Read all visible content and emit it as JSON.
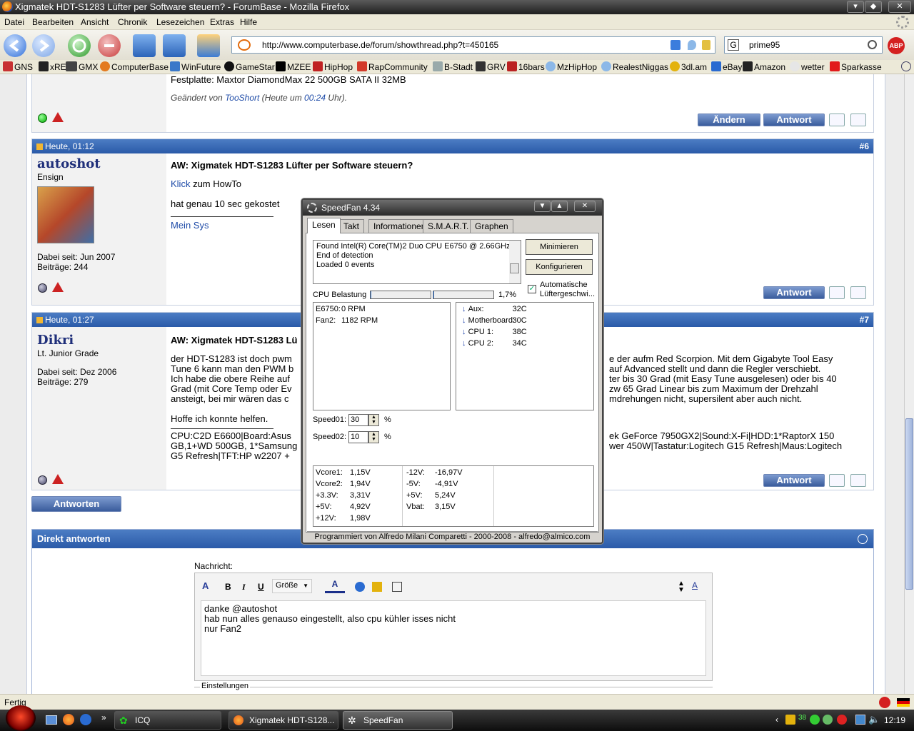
{
  "window": {
    "title": "Xigmatek HDT-S1283 Lüfter per Software steuern? - ForumBase - Mozilla Firefox"
  },
  "menu": [
    "Datei",
    "Bearbeiten",
    "Ansicht",
    "Chronik",
    "Lesezeichen",
    "Extras",
    "Hilfe"
  ],
  "nav": {
    "url": "http://www.computerbase.de/forum/showthread.php?t=450165",
    "search": "prime95"
  },
  "bookmarks": [
    "GNS",
    "xREL",
    "GMX",
    "ComputerBase",
    "WinFuture",
    "GameStar",
    "MZEE",
    "HipHop",
    "RapCommunity",
    "B-Stadt",
    "GRV",
    "16bars",
    "MzHipHop",
    "RealestNiggas",
    "3dl.am",
    "eBay",
    "Amazon",
    "wetter",
    "Sparkasse"
  ],
  "post_top": {
    "line1": "Festplatte: Maxtor DiamondMax 22 500GB SATA II 32MB",
    "edited_prefix": "Geändert von ",
    "edited_user": "TooShort",
    "edited_mid": " (Heute um ",
    "edited_time": "00:24",
    "edited_suffix": " Uhr).",
    "btn_edit": "Ändern",
    "btn_reply": "Antwort"
  },
  "post6": {
    "date": "Heute, 01:12",
    "num": "#6",
    "user": "autoshot",
    "rank": "Ensign",
    "joined": "Dabei seit: Jun 2007",
    "posts": "Beiträge: 244",
    "title": "AW: Xigmatek HDT-S1283 Lüfter per Software steuern?",
    "link": "Klick",
    "line1_rest": " zum HowTo",
    "line2": "hat genau 10 sec gekostet",
    "sig": "Mein Sys",
    "btn_reply": "Antwort"
  },
  "post7": {
    "date": "Heute, 01:27",
    "num": "#7",
    "user": "Dikri",
    "rank": "Lt. Junior Grade",
    "joined": "Dabei seit: Dez 2006",
    "posts": "Beiträge: 279",
    "title": "AW: Xigmatek HDT-S1283 Lü",
    "left_lines": [
      "der HDT-S1283 ist doch pwm",
      "Tune 6 kann man den PWM b",
      "Ich habe die obere Reihe auf",
      "Grad (mit Core Temp oder Ev",
      "ansteigt, bei mir wären das c"
    ],
    "right_lines": [
      "e der aufm Red Scorpion. Mit dem Gigabyte Tool Easy",
      "auf Advanced stellt und dann die Regler verschiebt.",
      "ter bis 30 Grad (mit Easy Tune ausgelesen) oder bis 40",
      "zw 65 Grad Linear bis zum Maximum der Drehzahl",
      "mdrehungen nicht, supersilent aber auch nicht."
    ],
    "hope": "Hoffe ich konnte helfen.",
    "sig_left": [
      "CPU:C2D E6600|Board:Asus",
      "GB,1+WD 500GB, 1*Samsung",
      "G5 Refresh|TFT:HP w2207 +"
    ],
    "sig_right": [
      "ek GeForce 7950GX2|Sound:X-Fi|HDD:1*RaptorX 150",
      "wer 450W|Tastatur:Logitech G15 Refresh|Maus:Logitech"
    ],
    "btn_reply": "Antwort"
  },
  "antworten": "Antworten",
  "direct": {
    "title": "Direkt antworten",
    "label": "Nachricht:",
    "size": "Größe",
    "message": [
      "danke @autoshot",
      "hab nun alles genauso eingestellt, also cpu kühler isses nicht",
      "nur Fan2"
    ],
    "settings": "Einstellungen"
  },
  "speedfan": {
    "title": "SpeedFan 4.34",
    "tabs": [
      "Lesen",
      "Takt",
      "Informationen",
      "S.M.A.R.T.",
      "Graphen"
    ],
    "log": [
      "Found Intel(R) Core(TM)2 Duo CPU E6750 @ 2.66GHz",
      "End of detection",
      "Loaded 0 events"
    ],
    "btn_min": "Minimieren",
    "btn_cfg": "Konfigurieren",
    "auto": [
      "Automatische",
      "Lüftergeschwi..."
    ],
    "auto_checked": true,
    "cpu_label": "CPU Belastung",
    "cpu_value": "1,7%",
    "fans": [
      {
        "name": "E6750:",
        "value": "0 RPM"
      },
      {
        "name": "Fan2:",
        "value": "1182 RPM"
      }
    ],
    "temps": [
      {
        "name": "Aux:",
        "value": "32C"
      },
      {
        "name": "Motherboard:",
        "value": "30C"
      },
      {
        "name": "CPU 1:",
        "value": "38C"
      },
      {
        "name": "CPU 2:",
        "value": "34C"
      }
    ],
    "speeds": [
      {
        "name": "Speed01:",
        "value": "30",
        "unit": "%"
      },
      {
        "name": "Speed02:",
        "value": "10",
        "unit": "%"
      }
    ],
    "volts_left": [
      {
        "name": "Vcore1:",
        "value": "1,15V"
      },
      {
        "name": "Vcore2:",
        "value": "1,94V"
      },
      {
        "name": "+3.3V:",
        "value": "3,31V"
      },
      {
        "name": "+5V:",
        "value": "4,92V"
      },
      {
        "name": "+12V:",
        "value": "1,98V"
      }
    ],
    "volts_right": [
      {
        "name": "-12V:",
        "value": "-16,97V"
      },
      {
        "name": "-5V:",
        "value": "-4,91V"
      },
      {
        "name": "+5V:",
        "value": "5,24V"
      },
      {
        "name": "Vbat:",
        "value": "3,15V"
      }
    ],
    "footer": "Programmiert von Alfredo Milani Comparetti - 2000-2008 - alfredo@almico.com"
  },
  "status": {
    "text": "Fertig"
  },
  "taskbar": {
    "tasks": [
      "ICQ",
      "Xigmatek HDT-S128...",
      "SpeedFan"
    ],
    "clock": "12:19",
    "tray_num": "38"
  },
  "colors": {
    "forum_header": "#2a5aa8",
    "window_chrome": "#2a2a2a",
    "link": "#1f4ca8"
  }
}
